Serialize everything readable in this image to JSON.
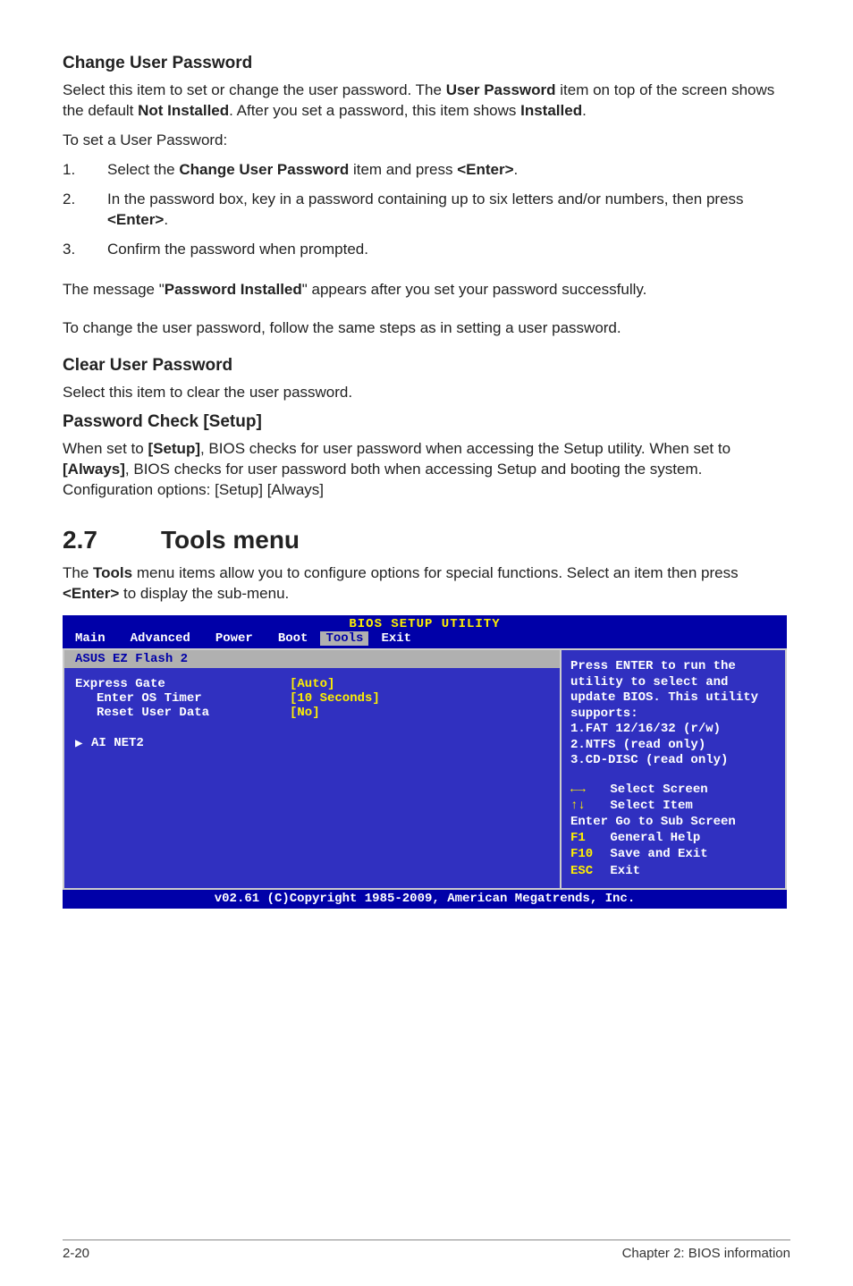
{
  "s1": {
    "title": "Change User Password",
    "p1a": "Select this item to set or change the user password. The ",
    "p1b": "User Password",
    "p1c": " item on top of the screen shows the default ",
    "p1d": "Not Installed",
    "p1e": ". After you set a password, this item shows ",
    "p1f": "Installed",
    "p1g": ".",
    "p2": "To set a User Password:",
    "li1_num": "1.",
    "li1a": "Select the ",
    "li1b": "Change User Password",
    "li1c": " item and press ",
    "li1d": "<Enter>",
    "li1e": ".",
    "li2_num": "2.",
    "li2a": "In the password box, key in a password containing up to six letters and/or numbers, then press ",
    "li2b": "<Enter>",
    "li2c": ".",
    "li3_num": "3.",
    "li3": "Confirm the password when prompted.",
    "p3a": "The message \"",
    "p3b": "Password Installed",
    "p3c": "\" appears after you set your password successfully.",
    "p4": "To change the user password, follow the same steps as in setting a user password."
  },
  "s2": {
    "title": "Clear User Password",
    "p1": "Select this item to clear the user password."
  },
  "s3": {
    "title": "Password Check [Setup]",
    "p1a": "When set to ",
    "p1b": "[Setup]",
    "p1c": ", BIOS checks for user password when accessing the Setup utility. When set to ",
    "p1d": "[Always]",
    "p1e": ", BIOS checks for user password both when accessing Setup and booting the system. Configuration options: [Setup] [Always]"
  },
  "h2": {
    "num": "2.7",
    "txt": "Tools menu"
  },
  "s4": {
    "p1a": "The ",
    "p1b": "Tools",
    "p1c": " menu items allow you to configure options for special functions. Select an item then press ",
    "p1d": "<Enter>",
    "p1e": " to display the sub-menu."
  },
  "bios": {
    "title": "BIOS SETUP UTILITY",
    "tabs": {
      "t1": "Main",
      "t2": "Advanced",
      "t3": "Power",
      "t4": "Boot",
      "t5": "Tools",
      "t6": "Exit"
    },
    "left": {
      "l1": "ASUS EZ Flash 2",
      "l2": "Express Gate",
      "l2v": "[Auto]",
      "l3": "Enter OS Timer",
      "l3v": "[10 Seconds]",
      "l4": "Reset User Data",
      "l4v": "[No]",
      "l5": "AI NET2"
    },
    "right": {
      "r1": "Press ENTER to run the utility to select and update BIOS. This utility supports:",
      "r2": "1.FAT 12/16/32 (r/w)",
      "r3": "2.NTFS (read only)",
      "r4": "3.CD-DISC (read only)",
      "n1a": "←→",
      "n1b": "Select Screen",
      "n2a": "↑↓",
      "n2b": "Select Item",
      "n3": "Enter Go to Sub Screen",
      "n4a": "F1",
      "n4b": "General Help",
      "n5a": "F10",
      "n5b": "Save and Exit",
      "n6a": "ESC",
      "n6b": "Exit"
    },
    "footer": "v02.61 (C)Copyright 1985-2009, American Megatrends, Inc."
  },
  "footer": {
    "left": "2-20",
    "right": "Chapter 2: BIOS information"
  }
}
